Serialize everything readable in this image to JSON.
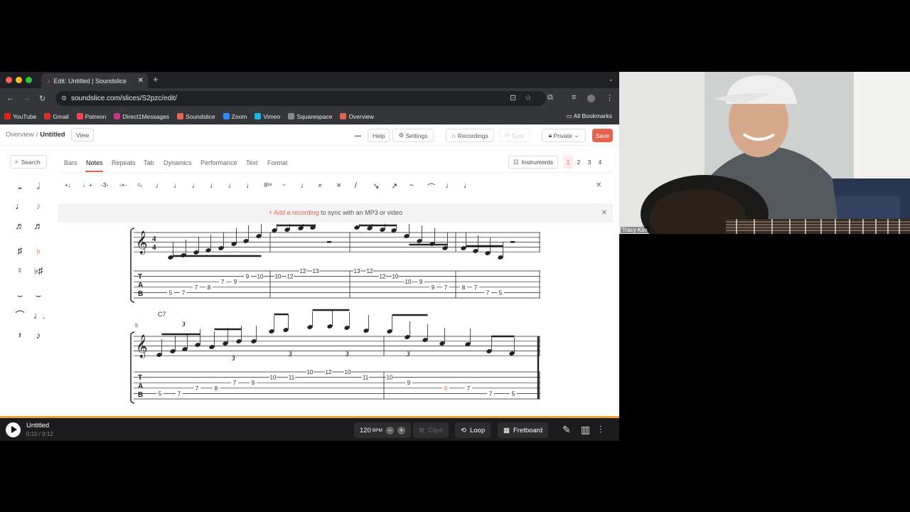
{
  "browser": {
    "tab_title": "Edit: Untitled | Soundslice",
    "url": "soundslice.com/slices/S2pzc/edit/",
    "bookmarks": [
      {
        "label": "YouTube",
        "color": "#e62117"
      },
      {
        "label": "Gmail",
        "color": "#d93025"
      },
      {
        "label": "Patreon",
        "color": "#ff424d"
      },
      {
        "label": "Direct1Messages",
        "color": "#c13584"
      },
      {
        "label": "Soundslice",
        "color": "#e8634d"
      },
      {
        "label": "Zoom",
        "color": "#2d8cff"
      },
      {
        "label": "Vimeo",
        "color": "#1ab7ea"
      },
      {
        "label": "Squarespace",
        "color": "#888888"
      },
      {
        "label": "Overview",
        "color": "#e8634d"
      }
    ],
    "all_bookmarks": "All Bookmarks"
  },
  "app": {
    "crumb_overview": "Overview",
    "crumb_sep": "/",
    "title": "Untitled",
    "view": "View",
    "help": "Help",
    "settings": "Settings",
    "recordings": "Recordings",
    "sync": "Sync",
    "privacy": "Private",
    "save": "Save"
  },
  "left": {
    "search": "Search"
  },
  "tabs": [
    "Bars",
    "Notes",
    "Repeats",
    "Tab",
    "Dynamics",
    "Performance",
    "Text",
    "Format"
  ],
  "active_tab": "Notes",
  "instruments": "Instruments",
  "pages": [
    "1",
    "2",
    "3",
    "4"
  ],
  "banner": {
    "link": "+ Add a recording",
    "rest": " to sync with an MP3 or video"
  },
  "score": {
    "chord1": "C7",
    "chord2": "C7",
    "measure_num": "5",
    "tab_row1": [
      "5",
      "7",
      "7",
      "8",
      "7",
      "9",
      "9",
      "10",
      "10",
      "12",
      "12",
      "13",
      "13",
      "12",
      "12",
      "10",
      "10",
      "9",
      "9",
      "7",
      "8",
      "7",
      "7",
      "5"
    ],
    "tab_row2": [
      "5",
      "7",
      "7",
      "8",
      "7",
      "9",
      "10",
      "11",
      "10",
      "12",
      "10",
      "11",
      "10",
      "9",
      "8",
      "7",
      "7",
      "5"
    ],
    "triplet": "3"
  },
  "player": {
    "title": "Untitled",
    "time": "0:10 / 0:12",
    "bpm": "120",
    "bpm_unit": "BPM",
    "clips": "Clips",
    "loop": "Loop",
    "fretboard": "Fretboard"
  },
  "video": {
    "name": "Tracy Kim"
  }
}
